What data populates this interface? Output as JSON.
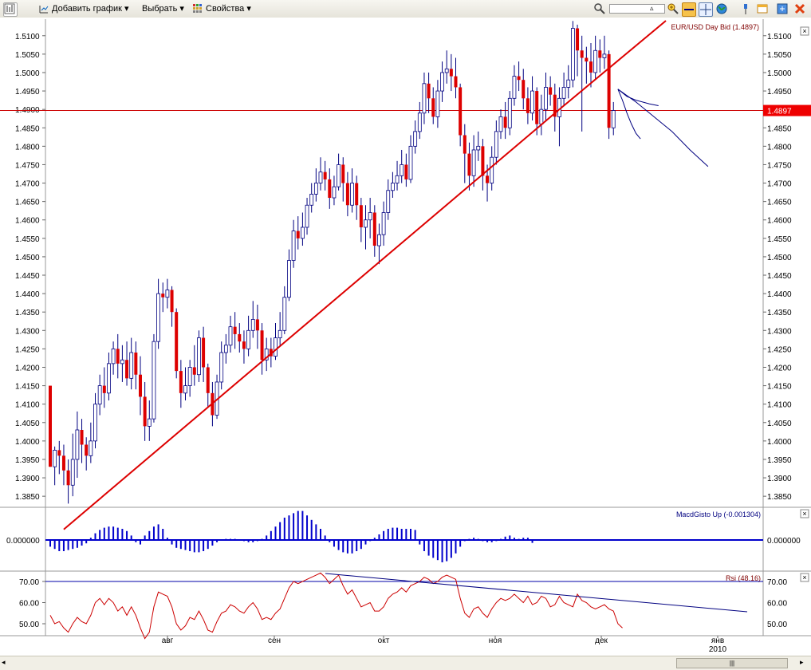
{
  "toolbar": {
    "add_chart_label": "Добавить график",
    "select_label": "Выбрать",
    "properties_label": "Свойства",
    "icons": [
      "chart-grid-icon",
      "add-chart-icon",
      "select-icon",
      "properties-icon",
      "zoom-icon",
      "zoom-slider",
      "zoom-in-icon",
      "line-tool-icon",
      "crosshair-icon",
      "globe-icon",
      "pin-icon",
      "window-icon",
      "export-icon",
      "refresh-icon",
      "close-icon"
    ]
  },
  "colors": {
    "up": "#ffffff",
    "down": "#dd0000",
    "wick": "#000080",
    "trend": "#dd0000",
    "hist": "#0000cc",
    "rsi": "#cc0000",
    "price_line": "#cc0000"
  },
  "price_panel": {
    "label": "EUR/USD Day Bid (1.4897)",
    "current_price_label": "1.4897",
    "current_price": 1.4897
  },
  "macd_panel": {
    "label": "MacdGisto Up (-0.001304)",
    "zero_label": "0.000000"
  },
  "rsi_panel": {
    "label": "Rsi (48.16)",
    "tick_labels": [
      "70.00",
      "60.00",
      "50.00"
    ]
  },
  "x_axis": {
    "month_labels": [
      "авг",
      "сен",
      "окт",
      "ноя",
      "дек",
      "янв"
    ],
    "year_label": "2010"
  },
  "chart_data": [
    {
      "type": "candlestick",
      "title": "EUR/USD Day Bid (1.4897)",
      "y_tick_labels": [
        "1.5100",
        "1.5050",
        "1.5000",
        "1.4950",
        "1.4900",
        "1.4850",
        "1.4800",
        "1.4750",
        "1.4700",
        "1.4650",
        "1.4600",
        "1.4550",
        "1.4500",
        "1.4450",
        "1.4400",
        "1.4350",
        "1.4300",
        "1.4250",
        "1.4200",
        "1.4150",
        "1.4100",
        "1.4050",
        "1.4000",
        "1.3950",
        "1.3900",
        "1.3850"
      ],
      "ylim": [
        1.382,
        1.5145
      ],
      "candles": [
        [
          1.415,
          1.393,
          1.415,
          1.393
        ],
        [
          1.393,
          1.3975,
          1.3985,
          1.388
        ],
        [
          1.3975,
          1.396,
          1.4,
          1.391
        ],
        [
          1.396,
          1.392,
          1.399,
          1.388
        ],
        [
          1.392,
          1.388,
          1.395,
          1.383
        ],
        [
          1.388,
          1.395,
          1.402,
          1.385
        ],
        [
          1.395,
          1.403,
          1.408,
          1.39
        ],
        [
          1.403,
          1.399,
          1.406,
          1.394
        ],
        [
          1.399,
          1.396,
          1.401,
          1.392
        ],
        [
          1.396,
          1.4,
          1.405,
          1.394
        ],
        [
          1.4,
          1.41,
          1.413,
          1.398
        ],
        [
          1.41,
          1.415,
          1.418,
          1.407
        ],
        [
          1.415,
          1.413,
          1.42,
          1.409
        ],
        [
          1.413,
          1.421,
          1.424,
          1.411
        ],
        [
          1.421,
          1.425,
          1.427,
          1.418
        ],
        [
          1.425,
          1.421,
          1.429,
          1.417
        ],
        [
          1.421,
          1.422,
          1.426,
          1.416
        ],
        [
          1.422,
          1.417,
          1.427,
          1.415
        ],
        [
          1.417,
          1.424,
          1.428,
          1.414
        ],
        [
          1.424,
          1.418,
          1.427,
          1.414
        ],
        [
          1.418,
          1.412,
          1.423,
          1.407
        ],
        [
          1.412,
          1.404,
          1.416,
          1.4
        ],
        [
          1.404,
          1.406,
          1.411,
          1.4
        ],
        [
          1.406,
          1.427,
          1.429,
          1.405
        ],
        [
          1.427,
          1.44,
          1.444,
          1.425
        ],
        [
          1.44,
          1.439,
          1.443,
          1.435
        ],
        [
          1.439,
          1.441,
          1.444,
          1.436
        ],
        [
          1.441,
          1.435,
          1.442,
          1.431
        ],
        [
          1.435,
          1.419,
          1.436,
          1.417
        ],
        [
          1.419,
          1.413,
          1.422,
          1.409
        ],
        [
          1.413,
          1.415,
          1.42,
          1.411
        ],
        [
          1.415,
          1.42,
          1.422,
          1.412
        ],
        [
          1.42,
          1.418,
          1.426,
          1.415
        ],
        [
          1.418,
          1.428,
          1.43,
          1.416
        ],
        [
          1.428,
          1.42,
          1.431,
          1.416
        ],
        [
          1.42,
          1.413,
          1.421,
          1.409
        ],
        [
          1.413,
          1.407,
          1.416,
          1.404
        ],
        [
          1.407,
          1.416,
          1.418,
          1.406
        ],
        [
          1.416,
          1.424,
          1.427,
          1.414
        ],
        [
          1.424,
          1.426,
          1.429,
          1.421
        ],
        [
          1.426,
          1.431,
          1.434,
          1.424
        ],
        [
          1.431,
          1.429,
          1.435,
          1.425
        ],
        [
          1.429,
          1.427,
          1.432,
          1.424
        ],
        [
          1.427,
          1.425,
          1.43,
          1.421
        ],
        [
          1.425,
          1.43,
          1.434,
          1.423
        ],
        [
          1.43,
          1.433,
          1.438,
          1.428
        ],
        [
          1.433,
          1.43,
          1.437,
          1.425
        ],
        [
          1.43,
          1.422,
          1.432,
          1.418
        ],
        [
          1.422,
          1.425,
          1.428,
          1.419
        ],
        [
          1.425,
          1.423,
          1.428,
          1.42
        ],
        [
          1.423,
          1.428,
          1.432,
          1.422
        ],
        [
          1.428,
          1.43,
          1.435,
          1.426
        ],
        [
          1.43,
          1.439,
          1.442,
          1.429
        ],
        [
          1.439,
          1.449,
          1.452,
          1.438
        ],
        [
          1.449,
          1.457,
          1.46,
          1.447
        ],
        [
          1.457,
          1.455,
          1.461,
          1.452
        ],
        [
          1.455,
          1.458,
          1.462,
          1.453
        ],
        [
          1.458,
          1.464,
          1.466,
          1.456
        ],
        [
          1.464,
          1.467,
          1.47,
          1.462
        ],
        [
          1.467,
          1.47,
          1.474,
          1.465
        ],
        [
          1.47,
          1.473,
          1.477,
          1.468
        ],
        [
          1.473,
          1.471,
          1.476,
          1.468
        ],
        [
          1.471,
          1.466,
          1.474,
          1.463
        ],
        [
          1.466,
          1.469,
          1.472,
          1.464
        ],
        [
          1.469,
          1.475,
          1.478,
          1.468
        ],
        [
          1.475,
          1.47,
          1.477,
          1.465
        ],
        [
          1.47,
          1.464,
          1.473,
          1.461
        ],
        [
          1.464,
          1.47,
          1.474,
          1.462
        ],
        [
          1.47,
          1.464,
          1.472,
          1.46
        ],
        [
          1.464,
          1.458,
          1.466,
          1.454
        ],
        [
          1.458,
          1.46,
          1.464,
          1.452
        ],
        [
          1.46,
          1.462,
          1.466,
          1.455
        ],
        [
          1.462,
          1.453,
          1.464,
          1.45
        ],
        [
          1.453,
          1.456,
          1.459,
          1.448
        ],
        [
          1.456,
          1.462,
          1.465,
          1.453
        ],
        [
          1.462,
          1.468,
          1.471,
          1.46
        ],
        [
          1.468,
          1.47,
          1.473,
          1.466
        ],
        [
          1.47,
          1.472,
          1.476,
          1.468
        ],
        [
          1.472,
          1.475,
          1.479,
          1.47
        ],
        [
          1.475,
          1.471,
          1.478,
          1.469
        ],
        [
          1.471,
          1.48,
          1.483,
          1.47
        ],
        [
          1.48,
          1.484,
          1.487,
          1.478
        ],
        [
          1.484,
          1.489,
          1.492,
          1.482
        ],
        [
          1.489,
          1.497,
          1.5,
          1.486
        ],
        [
          1.497,
          1.493,
          1.5,
          1.489
        ],
        [
          1.493,
          1.488,
          1.496,
          1.486
        ],
        [
          1.488,
          1.495,
          1.498,
          1.485
        ],
        [
          1.495,
          1.5,
          1.503,
          1.492
        ],
        [
          1.5,
          1.501,
          1.506,
          1.497
        ],
        [
          1.501,
          1.499,
          1.505,
          1.495
        ],
        [
          1.499,
          1.496,
          1.504,
          1.493
        ],
        [
          1.496,
          1.483,
          1.497,
          1.48
        ],
        [
          1.483,
          1.478,
          1.486,
          1.47
        ],
        [
          1.478,
          1.472,
          1.481,
          1.468
        ],
        [
          1.472,
          1.479,
          1.483,
          1.469
        ],
        [
          1.479,
          1.48,
          1.484,
          1.476
        ],
        [
          1.48,
          1.472,
          1.482,
          1.468
        ],
        [
          1.472,
          1.47,
          1.475,
          1.465
        ],
        [
          1.47,
          1.477,
          1.48,
          1.468
        ],
        [
          1.477,
          1.484,
          1.487,
          1.475
        ],
        [
          1.484,
          1.488,
          1.49,
          1.482
        ],
        [
          1.488,
          1.485,
          1.492,
          1.482
        ],
        [
          1.485,
          1.493,
          1.495,
          1.483
        ],
        [
          1.493,
          1.499,
          1.502,
          1.491
        ],
        [
          1.499,
          1.498,
          1.503,
          1.495
        ],
        [
          1.498,
          1.493,
          1.501,
          1.49
        ],
        [
          1.493,
          1.489,
          1.496,
          1.486
        ],
        [
          1.489,
          1.495,
          1.499,
          1.487
        ],
        [
          1.495,
          1.486,
          1.496,
          1.483
        ],
        [
          1.486,
          1.49,
          1.494,
          1.483
        ],
        [
          1.49,
          1.496,
          1.5,
          1.487
        ],
        [
          1.496,
          1.494,
          1.499,
          1.491
        ],
        [
          1.494,
          1.488,
          1.497,
          1.484
        ],
        [
          1.488,
          1.493,
          1.496,
          1.48
        ],
        [
          1.493,
          1.496,
          1.5,
          1.491
        ],
        [
          1.496,
          1.498,
          1.502,
          1.493
        ],
        [
          1.498,
          1.512,
          1.514,
          1.496
        ],
        [
          1.512,
          1.506,
          1.513,
          1.499
        ],
        [
          1.506,
          1.504,
          1.51,
          1.484
        ],
        [
          1.504,
          1.503,
          1.507,
          1.497
        ],
        [
          1.503,
          1.5,
          1.508,
          1.496
        ],
        [
          1.5,
          1.506,
          1.51,
          1.498
        ],
        [
          1.506,
          1.504,
          1.509,
          1.5
        ],
        [
          1.504,
          1.505,
          1.51,
          1.501
        ],
        [
          1.505,
          1.485,
          1.506,
          1.482
        ],
        [
          1.485,
          1.4897,
          1.492,
          1.483
        ]
      ],
      "macd_hist": [
        -0.003,
        -0.004,
        -0.005,
        -0.005,
        -0.0045,
        -0.004,
        -0.0035,
        -0.0025,
        -0.0015,
        0.001,
        0.003,
        0.0045,
        0.0055,
        0.006,
        0.006,
        0.0055,
        0.005,
        0.004,
        0.002,
        -0.001,
        -0.002,
        0.002,
        0.004,
        0.006,
        0.007,
        0.005,
        0.001,
        -0.002,
        -0.0035,
        -0.004,
        -0.0045,
        -0.005,
        -0.0055,
        -0.0055,
        -0.005,
        -0.004,
        -0.0025,
        -0.001,
        0.0,
        0.0005,
        0.0005,
        0.0005,
        0.0,
        -0.0005,
        -0.001,
        -0.001,
        -0.0005,
        0.0005,
        0.002,
        0.004,
        0.006,
        0.008,
        0.01,
        0.011,
        0.012,
        0.013,
        0.013,
        0.011,
        0.009,
        0.007,
        0.005,
        0.002,
        -0.001,
        -0.003,
        -0.0045,
        -0.0055,
        -0.006,
        -0.006,
        -0.005,
        -0.004,
        -0.002,
        -0.0005,
        0.001,
        0.0025,
        0.004,
        0.005,
        0.0055,
        0.0055,
        0.005,
        0.005,
        0.005,
        0.0045,
        -0.002,
        -0.005,
        -0.007,
        -0.008,
        -0.009,
        -0.01,
        -0.0095,
        -0.008,
        -0.006,
        -0.003,
        -0.0005,
        0.0005,
        0.001,
        0.0005,
        -0.0005,
        -0.001,
        -0.001,
        -0.0005,
        0.0005,
        0.0015,
        0.002,
        0.001,
        0.0005,
        0.001,
        0.001,
        -0.0013
      ],
      "rsi": [
        54,
        50,
        51,
        48,
        46,
        50,
        53,
        51,
        50,
        54,
        60,
        62,
        59,
        62,
        60,
        56,
        58,
        54,
        58,
        54,
        48,
        43,
        46,
        58,
        65,
        64,
        63,
        58,
        50,
        47,
        49,
        53,
        52,
        56,
        52,
        47,
        46,
        51,
        55,
        56,
        59,
        58,
        56,
        55,
        58,
        60,
        57,
        52,
        53,
        52,
        55,
        57,
        62,
        67,
        70,
        69,
        70,
        71,
        72,
        73,
        74,
        72,
        69,
        71,
        73,
        68,
        64,
        66,
        62,
        58,
        59,
        60,
        56,
        56,
        58,
        62,
        64,
        65,
        67,
        65,
        68,
        69,
        70,
        72,
        71,
        69,
        70,
        72,
        73,
        72,
        71,
        62,
        55,
        53,
        57,
        58,
        55,
        53,
        57,
        60,
        62,
        61,
        62,
        64,
        62,
        60,
        63,
        59,
        60,
        63,
        62,
        58,
        59,
        63,
        60,
        59,
        58,
        64,
        61,
        60,
        58,
        57,
        58,
        59,
        57,
        56,
        50,
        48
      ],
      "trendline_price": [
        [
          3,
          1.376
        ],
        [
          113,
          1.49
        ]
      ],
      "rsi_resistance": 70,
      "forecast_lines": [
        [
          [
            126,
            1.4955
          ],
          [
            130,
            1.492
          ],
          [
            134,
            1.488
          ],
          [
            138,
            1.484
          ],
          [
            142,
            1.479
          ],
          [
            146,
            1.4745
          ]
        ],
        [
          [
            126,
            1.4955
          ],
          [
            127,
            1.4925
          ],
          [
            128,
            1.489
          ],
          [
            129,
            1.486
          ],
          [
            130,
            1.4835
          ],
          [
            131,
            1.482
          ]
        ],
        [
          [
            126,
            1.4955
          ],
          [
            128,
            1.4935
          ],
          [
            130,
            1.4925
          ],
          [
            133,
            1.4915
          ],
          [
            135,
            1.491
          ]
        ]
      ]
    }
  ]
}
